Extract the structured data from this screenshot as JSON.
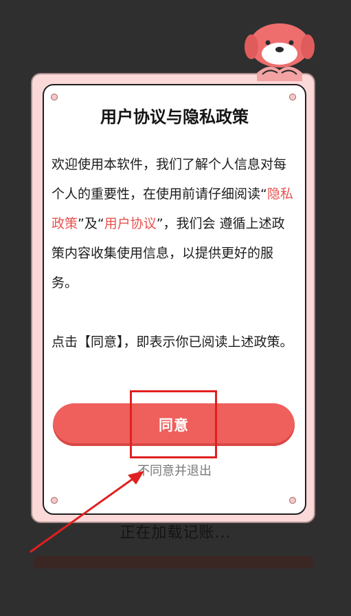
{
  "dialog": {
    "title": "用户协议与隐私政策",
    "intro_1": "欢迎使用本软件，我们了解个人信息对每个人的重要性，在使用前请仔细阅读",
    "quote_open_1": "“",
    "privacy_link": "隐私政策",
    "joiner": "”及“",
    "user_agreement_link": "用户协议",
    "intro_2": "”，我们会 遵循上述政策内容收集使用信息，以提供更好的服务。",
    "consent_note": "点击【同意】，即表示你已阅读上述政策。",
    "agree_label": "同意",
    "decline_label": "不同意并退出"
  },
  "background": {
    "loading_text": "正在加载记账..."
  },
  "colors": {
    "accent": "#ef5f5c",
    "link": "#e8534f",
    "frame": "#fbd9d9",
    "annotation": "#e02020"
  }
}
